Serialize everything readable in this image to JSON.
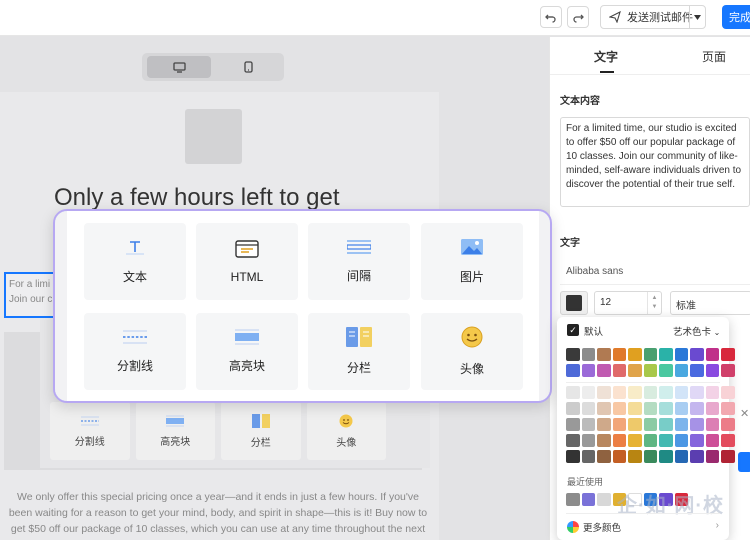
{
  "toolbar": {
    "undo_icon": "undo-icon",
    "redo_icon": "redo-icon",
    "send_test_label": "发送测试邮件",
    "done_label": "完成"
  },
  "canvas": {
    "device_modes": [
      "desktop-icon",
      "mobile-icon"
    ],
    "headline": "Only a few hours left to get",
    "selected_text_lines": [
      "For a limi",
      "Join our c"
    ],
    "ghost_blocks": [
      "分割线",
      "高亮块",
      "分栏",
      "头像"
    ],
    "body_paragraph": "We only offer this special pricing once a year—and it ends in just a few hours. If you've been waiting for a reason to get your mind, body, and spirit in shape—this is it! Buy now to get $50 off our package of 10 classes, which you can use at any time throughout the next year."
  },
  "picker": {
    "blocks": [
      {
        "label": "文本",
        "icon": "text-icon"
      },
      {
        "label": "HTML",
        "icon": "html-icon"
      },
      {
        "label": "间隔",
        "icon": "spacer-icon"
      },
      {
        "label": "图片",
        "icon": "image-icon"
      },
      {
        "label": "分割线",
        "icon": "divider-icon"
      },
      {
        "label": "高亮块",
        "icon": "highlight-icon"
      },
      {
        "label": "分栏",
        "icon": "columns-icon"
      },
      {
        "label": "头像",
        "icon": "avatar-emoji-icon"
      }
    ]
  },
  "panel": {
    "tabs": [
      "文字",
      "页面"
    ],
    "content_label": "文本内容",
    "content_text": "For a limited time, our studio is excited to offer $50 off our popular package of 10 classes. Join our community of like-minded, self-aware individuals driven to discover the potential of their true self.",
    "font_label": "文字",
    "font_family": "Alibaba sans",
    "font_size": "12",
    "line_height": "标准"
  },
  "color_popup": {
    "default_label": "默认",
    "art_label": "艺术色卡",
    "recent_label": "最近使用",
    "more_label": "更多颜色",
    "watermark": "企·如·网·校",
    "palette_row1": [
      "#3a3a3a",
      "#8c8c8c",
      "#b07a52",
      "#e07a2a",
      "#e0a020",
      "#49a070",
      "#2ab2a8",
      "#2a78d8",
      "#6a4ad0",
      "#c0308a",
      "#d8283c"
    ],
    "palette_row2": [
      "#4e6ad8",
      "#9b6ad8",
      "#c05ab0",
      "#e06a6a",
      "#e0a44a",
      "#a8c84a",
      "#4ac8a0",
      "#4aa8e0",
      "#4a6ae0",
      "#8a4ae0",
      "#d0406a"
    ],
    "tint_row1": [
      "#e6e6e6",
      "#ededed",
      "#efe1d6",
      "#fbe2cf",
      "#f8ecc8",
      "#d8ecdf",
      "#d0eeec",
      "#d2e4f8",
      "#e0d8f6",
      "#f3d2e6",
      "#f8d2d6"
    ],
    "tint_row2": [
      "#cccccc",
      "#dcdcdc",
      "#e0c6b2",
      "#f8c8a4",
      "#f4dc98",
      "#b4dcc2",
      "#a6dedb",
      "#a8cdf2",
      "#c4b6ee",
      "#e8a8cd",
      "#f2a8b0"
    ],
    "tint_row3": [
      "#999999",
      "#bbbbbb",
      "#cfa98a",
      "#f2a678",
      "#eec96a",
      "#8ccba4",
      "#78cdc8",
      "#7cb4ec",
      "#a692e6",
      "#dc7eb4",
      "#ec7c88"
    ],
    "tint_row4": [
      "#666666",
      "#999999",
      "#b8875f",
      "#ec7f44",
      "#e6b234",
      "#5fb683",
      "#44b9b2",
      "#4c97e4",
      "#8566dc",
      "#cd4f98",
      "#e34c5e"
    ],
    "tint_row5": [
      "#333333",
      "#666666",
      "#8f6240",
      "#c45f24",
      "#b88512",
      "#3a8a5c",
      "#1f8a84",
      "#2668b4",
      "#5b3eb0",
      "#9a2a6e",
      "#b02434"
    ],
    "recent_colors": [
      "#8c8c8c",
      "#7a72d8",
      "#d8d8d8",
      "#e0b030",
      "#ffffff",
      "#2a78d8",
      "#6a4ad0",
      "#d8283c"
    ]
  }
}
